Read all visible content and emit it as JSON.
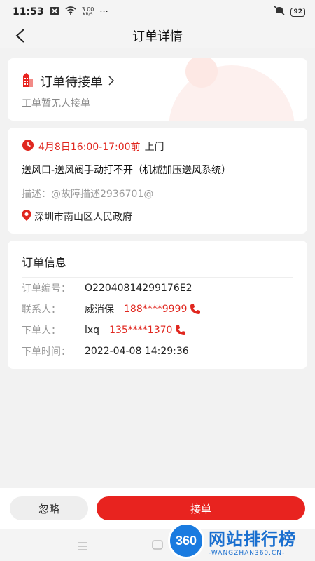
{
  "status_bar": {
    "time": "11:53",
    "net_speed_value": "3.00",
    "net_speed_unit": "KB/S",
    "more": "···",
    "battery": "92"
  },
  "nav": {
    "title": "订单详情"
  },
  "order_status": {
    "title": "订单待接单",
    "subtitle": "工单暂无人接单"
  },
  "detail": {
    "time_window": "4月8日16:00-17:00前",
    "visit_type": "上门",
    "fault_title": "送风口-送风阀手动打不开（机械加压送风系统）",
    "description": "描述：@故障描述2936701@",
    "address": "深圳市南山区人民政府"
  },
  "order_info": {
    "heading": "订单信息",
    "rows": [
      {
        "label": "订单编号：",
        "value": "O22040814299176E2",
        "phone": ""
      },
      {
        "label": "联系人：",
        "value": "威消保",
        "phone": "188****9999"
      },
      {
        "label": "下单人：",
        "value": "lxq",
        "phone": "135****1370"
      },
      {
        "label": "下单时间：",
        "value": "2022-04-08 14:29:36",
        "phone": ""
      }
    ]
  },
  "actions": {
    "ignore_label": "忽略",
    "accept_label": "接单"
  },
  "watermark": {
    "badge": "360",
    "title": "网站排行榜",
    "url": "-WANGZHAN360.CN-"
  },
  "colors": {
    "accent_red": "#e8231f",
    "text_red": "#e0271f",
    "brand_blue": "#1a7be0"
  },
  "icons": {
    "back": "chevron-left-icon",
    "building": "building-icon",
    "clock": "clock-icon",
    "location": "location-pin-icon",
    "phone": "phone-icon"
  }
}
